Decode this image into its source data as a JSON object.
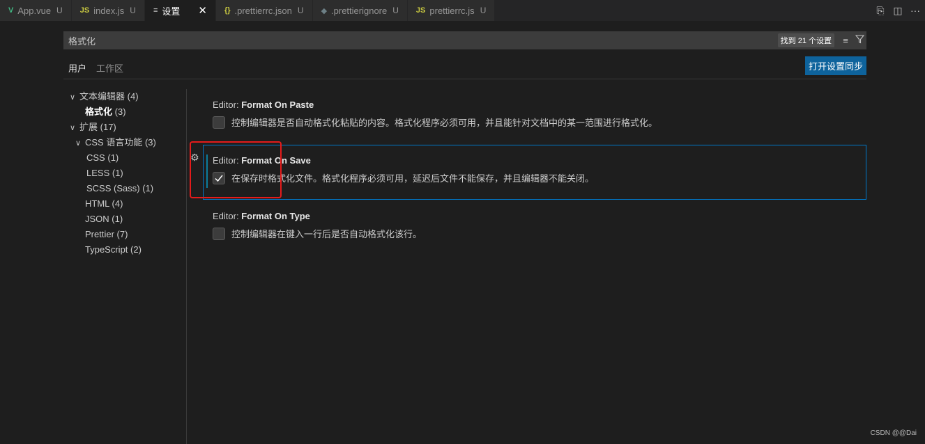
{
  "tabs": [
    {
      "icon": "V",
      "label": "App.vue",
      "badge": "U",
      "icon_class": "icon-vue",
      "icon_name": "vue-icon"
    },
    {
      "icon": "JS",
      "label": "index.js",
      "badge": "U",
      "icon_class": "icon-js",
      "icon_name": "js-icon"
    },
    {
      "icon": "≡",
      "label": "设置",
      "close": "✕",
      "icon_class": "icon-settings",
      "icon_name": "settings-file-icon",
      "active": true
    },
    {
      "icon": "{}",
      "label": ".prettierrc.json",
      "badge": "U",
      "icon_class": "icon-json",
      "icon_name": "json-icon"
    },
    {
      "icon": "◆",
      "label": ".prettierignore",
      "badge": "U",
      "icon_class": "icon-ignore",
      "icon_name": "ignore-file-icon"
    },
    {
      "icon": "JS",
      "label": "prettierrc.js",
      "badge": "U",
      "icon_class": "icon-js",
      "icon_name": "js-icon"
    }
  ],
  "tab_actions": [
    "open-settings-json-icon",
    "split-editor-icon",
    "more-actions-icon"
  ],
  "search": {
    "value": "格式化",
    "result_count": "找到 21 个设置",
    "clear_icon": "clear-filter-icon",
    "filter_icon": "filter-icon"
  },
  "scope_tabs": {
    "user": "用户",
    "workspace": "工作区"
  },
  "sync_button": "打开设置同步",
  "toc": [
    {
      "chev": "∨",
      "label": "文本编辑器",
      "count": "(4)",
      "indent": 0
    },
    {
      "chev": "",
      "label": "格式化",
      "count": "(3)",
      "indent": 1,
      "bold": true
    },
    {
      "chev": "∨",
      "label": "扩展",
      "count": "(17)",
      "indent": 0
    },
    {
      "chev": "∨",
      "label": "CSS 语言功能",
      "count": "(3)",
      "indent": 1
    },
    {
      "chev": "",
      "label": "CSS",
      "count": "(1)",
      "indent": 2
    },
    {
      "chev": "",
      "label": "LESS",
      "count": "(1)",
      "indent": 2
    },
    {
      "chev": "",
      "label": "SCSS (Sass)",
      "count": "(1)",
      "indent": 2
    },
    {
      "chev": "",
      "label": "HTML",
      "count": "(4)",
      "indent": 1
    },
    {
      "chev": "",
      "label": "JSON",
      "count": "(1)",
      "indent": 1
    },
    {
      "chev": "",
      "label": "Prettier",
      "count": "(7)",
      "indent": 1
    },
    {
      "chev": "",
      "label": "TypeScript",
      "count": "(2)",
      "indent": 1
    }
  ],
  "settings": {
    "paste": {
      "category": "Editor: ",
      "name": "Format On Paste",
      "checked": false,
      "description": "控制编辑器是否自动格式化粘贴的内容。格式化程序必须可用，并且能针对文档中的某一范围进行格式化。"
    },
    "save": {
      "category": "Editor: ",
      "name": "Format On Save",
      "checked": true,
      "description": "在保存时格式化文件。格式化程序必须可用，延迟后文件不能保存，并且编辑器不能关闭。"
    },
    "type": {
      "category": "Editor: ",
      "name": "Format On Type",
      "checked": false,
      "description": "控制编辑器在键入一行后是否自动格式化该行。"
    }
  },
  "watermark": "CSDN @@Dai",
  "colors": {
    "accent": "#007acc",
    "button": "#0e639c",
    "highlight": "#e41b1b"
  }
}
